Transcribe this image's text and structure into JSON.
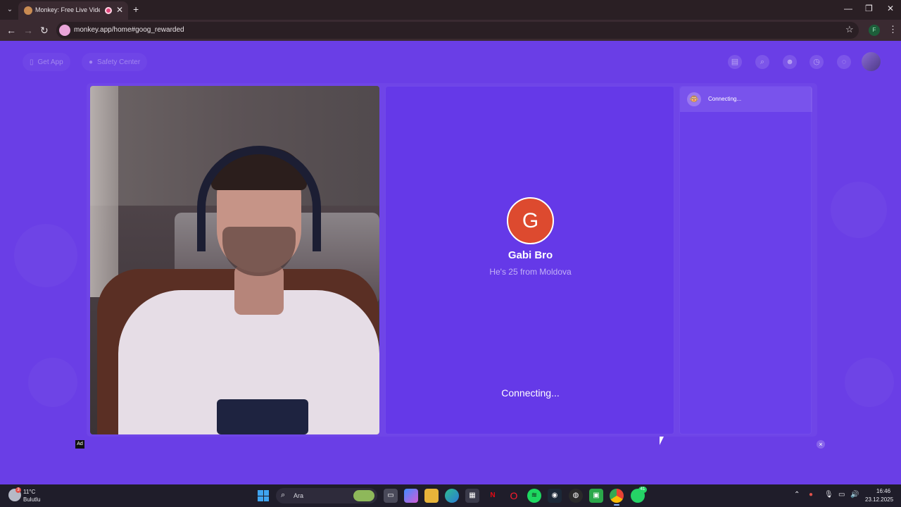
{
  "browser": {
    "tab_title": "Monkey: Free Live Video Ch",
    "url": "monkey.app/home#goog_rewarded",
    "profile_initial": "F"
  },
  "app": {
    "top_left": {
      "get_app": "Get App",
      "safety_center": "Safety Center"
    },
    "match": {
      "avatar_letter": "G",
      "name": "Gabi Bro",
      "subtitle": "He's 25 from Moldova",
      "status": "Connecting..."
    },
    "chat": {
      "status": "Connecting..."
    },
    "ad_label": "Ad",
    "ad_close": "×"
  },
  "taskbar": {
    "weather_temp": "11°C",
    "weather_condition": "Bulutlu",
    "weather_badge": "3",
    "search_placeholder": "Ara",
    "whatsapp_badge": "41",
    "time": "16:46",
    "date": "23.12.2025"
  },
  "colors": {
    "app_bg": "#6a3ee6",
    "avatar_bg": "#dd4a2f",
    "taskbar_bg": "#1f1d2a"
  }
}
